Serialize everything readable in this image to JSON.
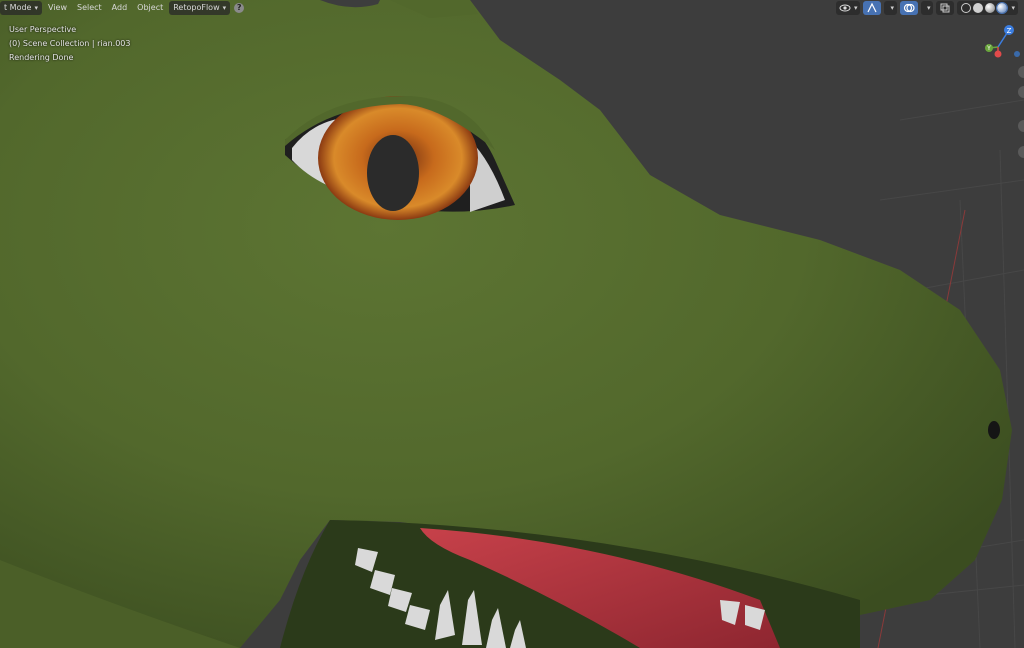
{
  "header": {
    "mode_label": "t Mode",
    "menu": [
      "View",
      "Select",
      "Add",
      "Object"
    ],
    "addon_label": "RetopoFlow"
  },
  "overlay": {
    "view_name": "User Perspective",
    "collection_line": "(0) Scene Collection | rian.003",
    "status": "Rendering Done"
  },
  "gizmo": {
    "axis_z": "Z",
    "axis_y": "Y"
  },
  "icons": {
    "help": "?",
    "visibility": "eye-icon",
    "gizmo_toggle": "gizmo-icon",
    "overlay_toggle": "overlay-icon",
    "xray": "xray-icon",
    "shading_wire": "wireframe-shading-icon",
    "shading_solid": "solid-shading-icon",
    "shading_material": "material-shading-icon",
    "shading_rendered": "rendered-shading-icon"
  },
  "colors": {
    "viewport_bg": "#3d3d3d",
    "skin": "#556b2e",
    "iris": "#c7731f",
    "tongue": "#a8303a",
    "active_blue": "#4772b3",
    "axis_x": "#e04a4a",
    "axis_y": "#6aa63c",
    "axis_z": "#3b7de0"
  }
}
